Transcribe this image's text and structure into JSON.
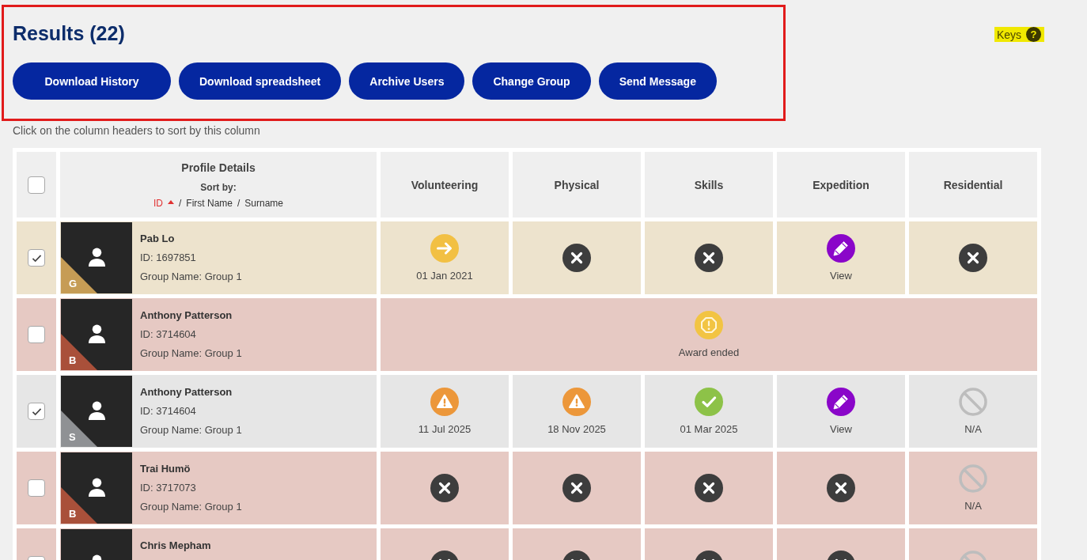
{
  "results_panel": {
    "outlined": true,
    "title": "Results (22)",
    "buttons": [
      "Download History",
      "Download spreadsheet",
      "Archive Users",
      "Change Group",
      "Send Message"
    ]
  },
  "keys": {
    "label": "Keys",
    "icon": "?",
    "highlighted": true
  },
  "hint": "Click on the column headers to sort by this column",
  "table": {
    "select_all": {
      "checked": false
    },
    "profile_header": {
      "title": "Profile Details",
      "sort_label": "Sort by:",
      "separator": "/",
      "ascending": true,
      "sort_options": [
        {
          "label": "ID",
          "selected": true
        },
        {
          "label": "First Name",
          "selected": false
        },
        {
          "label": "Surname",
          "selected": false
        }
      ]
    },
    "columns": [
      "Volunteering",
      "Physical",
      "Skills",
      "Expedition",
      "Residential"
    ],
    "rows": [
      {
        "checked": true,
        "kind": "gold",
        "badge": "G",
        "name": "Pab Lo",
        "id": "ID: 1697851",
        "group": "Group Name: Group 1",
        "cells": [
          {
            "kind": "arrow",
            "caption": "01 Jan 2021"
          },
          {
            "kind": "cross"
          },
          {
            "kind": "cross"
          },
          {
            "kind": "edit",
            "caption": "View"
          },
          {
            "kind": "cross"
          }
        ]
      },
      {
        "checked": false,
        "kind": "bronze",
        "badge": "B",
        "name": "Anthony Patterson",
        "id": "ID: 3714604",
        "group": "Group Name: Group 1",
        "notice": {
          "kind": "ended",
          "caption": "Award ended"
        }
      },
      {
        "checked": true,
        "kind": "silver",
        "badge": "S",
        "name": "Anthony Patterson",
        "id": "ID: 3714604",
        "group": "Group Name: Group 1",
        "cells": [
          {
            "kind": "warning",
            "caption": "11 Jul 2025"
          },
          {
            "kind": "warning",
            "caption": "18 Nov 2025"
          },
          {
            "kind": "tick",
            "caption": "01 Mar 2025"
          },
          {
            "kind": "edit",
            "caption": "View"
          },
          {
            "kind": "na",
            "caption": "N/A"
          }
        ]
      },
      {
        "checked": false,
        "kind": "bronze",
        "badge": "B",
        "name": "Trai Humö",
        "id": "ID: 3717073",
        "group": "Group Name: Group 1",
        "cells": [
          {
            "kind": "cross"
          },
          {
            "kind": "cross"
          },
          {
            "kind": "cross"
          },
          {
            "kind": "cross"
          },
          {
            "kind": "na",
            "caption": "N/A"
          }
        ]
      },
      {
        "kind": "bronze",
        "name": "Chris Mepham",
        "cells": [
          {
            "kind": "cross"
          },
          {
            "kind": "cross"
          },
          {
            "kind": "cross"
          },
          {
            "kind": "cross"
          },
          {
            "kind": "na"
          }
        ]
      }
    ]
  }
}
